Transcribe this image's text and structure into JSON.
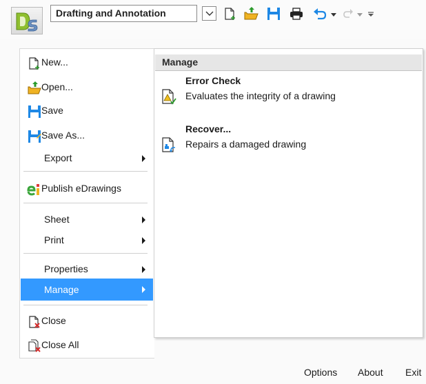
{
  "toolbar": {
    "workspace_value": "Drafting and Annotation"
  },
  "menu": {
    "items": [
      {
        "label": "New...",
        "icon": "new-document-icon"
      },
      {
        "label": "Open...",
        "icon": "open-folder-icon"
      },
      {
        "label": "Save",
        "icon": "save-icon"
      },
      {
        "label": "Save As...",
        "icon": "save-as-icon"
      },
      {
        "label": "Export",
        "icon": ""
      },
      {
        "label": "Publish eDrawings",
        "icon": "edrawings-icon"
      },
      {
        "label": "Sheet",
        "icon": ""
      },
      {
        "label": "Print",
        "icon": ""
      },
      {
        "label": "Properties",
        "icon": ""
      },
      {
        "label": "Manage",
        "icon": ""
      },
      {
        "label": "Close",
        "icon": "close-document-icon"
      },
      {
        "label": "Close All",
        "icon": "close-all-icon"
      }
    ],
    "active_item": "Manage",
    "accent_color": "#3399ff"
  },
  "flyout": {
    "title": "Manage",
    "items": [
      {
        "title": "Error Check",
        "description": "Evaluates the integrity of a drawing",
        "icon": "error-check-icon"
      },
      {
        "title": "Recover...",
        "description": "Repairs a damaged drawing",
        "icon": "recover-icon"
      }
    ]
  },
  "footer": {
    "options_label": "Options",
    "about_label": "About",
    "exit_label": "Exit"
  }
}
